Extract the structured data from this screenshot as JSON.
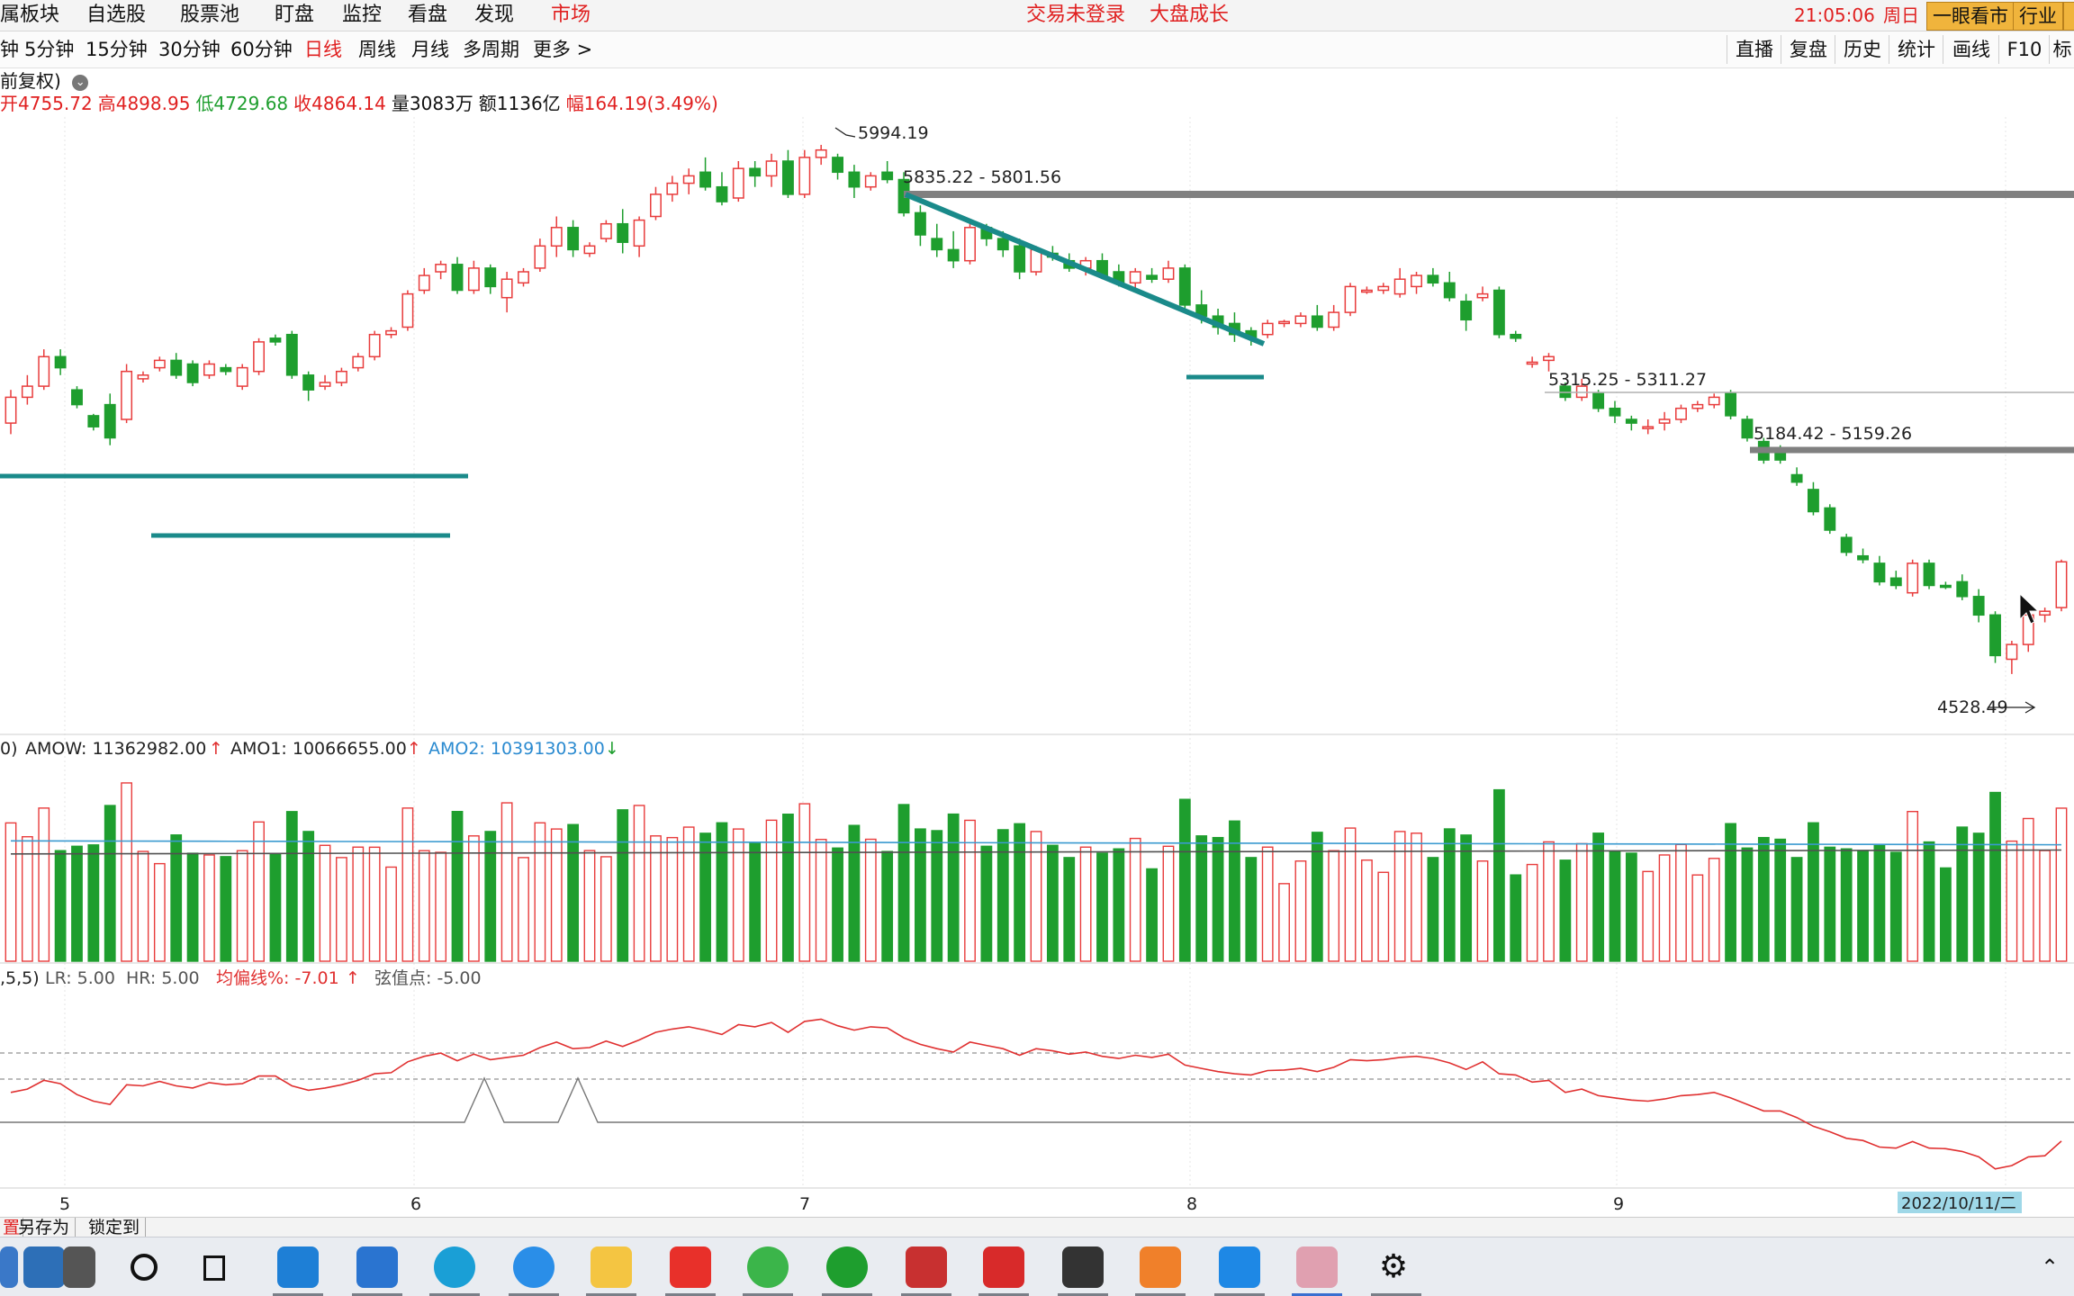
{
  "menu": {
    "items": [
      "属板块",
      "自选股",
      "股票池",
      "盯盘",
      "监控",
      "看盘",
      "发现",
      "市场"
    ],
    "status_text": "交易未登录",
    "center_text": "大盘成长",
    "clock": "21:05:06",
    "weekday": "周日",
    "badge_1": "一眼看市",
    "badge_2": "行业"
  },
  "period": {
    "items": [
      "钟",
      "5分钟",
      "15分钟",
      "30分钟",
      "60分钟",
      "日线",
      "周线",
      "月线",
      "多周期",
      "更多 >"
    ],
    "active": "日线"
  },
  "tools": [
    "直播",
    "复盘",
    "历史",
    "统计",
    "画线",
    "F10",
    "标"
  ],
  "info": {
    "adjust_label": "前复权)",
    "open": "开4755.72",
    "high": "高4898.95",
    "low": "低4729.68",
    "close": "收4864.14",
    "volume": "量3083万",
    "amount": "额1136亿",
    "change": "幅164.19(3.49%)"
  },
  "colors": {
    "up": "#e83c3c",
    "down": "#1e9e2e",
    "trendline": "#1a8a8a",
    "resistance": "#808080",
    "amo_ma1": "#3a9ad0",
    "amo_ma2": "#505050",
    "osc": "#e03030"
  },
  "annotations": {
    "peak": "5994.19",
    "range_1": "5835.22 - 5801.56",
    "range_2": "5315.25 - 5311.27",
    "range_3": "5184.42 - 5159.26",
    "low": "4528.49"
  },
  "amo": {
    "prefix": "0)",
    "amow": "AMOW: 11362982.00",
    "amo1": "AMO1: 10066655.00",
    "amo2": "AMO2: 10391303.00"
  },
  "osc": {
    "prefix": ",5,5)",
    "lr": "LR: 5.00",
    "hr": "HR: 5.00",
    "bias": "均偏线%: -7.01",
    "chord": "弦值点: -5.00"
  },
  "xaxis": {
    "ticks": [
      "5",
      "6",
      "7",
      "8",
      "9"
    ],
    "cursor_date": "2022/10/11/二"
  },
  "bottom_tabs": [
    "置",
    "另存为",
    "锁定到"
  ],
  "chart_data": {
    "type": "candlestick",
    "price_range": [
      4450,
      6050
    ],
    "candles": [
      [
        5240,
        5330,
        5210,
        5310
      ],
      [
        5310,
        5370,
        5290,
        5340
      ],
      [
        5340,
        5440,
        5330,
        5420
      ],
      [
        5420,
        5440,
        5370,
        5390
      ],
      [
        5330,
        5340,
        5280,
        5290
      ],
      [
        5260,
        5265,
        5220,
        5230
      ],
      [
        5290,
        5320,
        5180,
        5200
      ],
      [
        5250,
        5400,
        5240,
        5380
      ],
      [
        5360,
        5380,
        5350,
        5370
      ],
      [
        5390,
        5420,
        5380,
        5410
      ],
      [
        5410,
        5430,
        5360,
        5370
      ],
      [
        5400,
        5410,
        5340,
        5350
      ],
      [
        5370,
        5410,
        5360,
        5400
      ],
      [
        5390,
        5400,
        5370,
        5380
      ],
      [
        5340,
        5400,
        5330,
        5390
      ],
      [
        5380,
        5470,
        5370,
        5460
      ],
      [
        5470,
        5480,
        5450,
        5460
      ],
      [
        5480,
        5490,
        5360,
        5370
      ],
      [
        5370,
        5380,
        5300,
        5330
      ],
      [
        5340,
        5370,
        5330,
        5350
      ],
      [
        5350,
        5390,
        5340,
        5380
      ],
      [
        5390,
        5430,
        5380,
        5420
      ],
      [
        5420,
        5490,
        5410,
        5480
      ],
      [
        5480,
        5500,
        5470,
        5490
      ],
      [
        5500,
        5600,
        5490,
        5590
      ],
      [
        5600,
        5660,
        5590,
        5640
      ],
      [
        5650,
        5680,
        5630,
        5670
      ],
      [
        5670,
        5690,
        5590,
        5600
      ],
      [
        5600,
        5680,
        5590,
        5660
      ],
      [
        5660,
        5670,
        5590,
        5610
      ],
      [
        5580,
        5650,
        5540,
        5630
      ],
      [
        5620,
        5660,
        5610,
        5650
      ],
      [
        5660,
        5740,
        5650,
        5720
      ],
      [
        5720,
        5800,
        5690,
        5770
      ],
      [
        5770,
        5790,
        5690,
        5710
      ],
      [
        5700,
        5730,
        5690,
        5720
      ],
      [
        5740,
        5790,
        5730,
        5780
      ],
      [
        5780,
        5820,
        5700,
        5730
      ],
      [
        5720,
        5800,
        5690,
        5790
      ],
      [
        5800,
        5880,
        5790,
        5860
      ],
      [
        5860,
        5910,
        5840,
        5890
      ],
      [
        5890,
        5930,
        5860,
        5910
      ],
      [
        5920,
        5960,
        5870,
        5880
      ],
      [
        5880,
        5920,
        5830,
        5840
      ],
      [
        5850,
        5950,
        5840,
        5930
      ],
      [
        5930,
        5950,
        5880,
        5910
      ],
      [
        5910,
        5970,
        5880,
        5950
      ],
      [
        5950,
        5980,
        5850,
        5860
      ],
      [
        5860,
        5980,
        5850,
        5960
      ],
      [
        5960,
        5994,
        5940,
        5980
      ],
      [
        5960,
        5970,
        5900,
        5920
      ],
      [
        5920,
        5940,
        5850,
        5880
      ],
      [
        5880,
        5920,
        5870,
        5910
      ],
      [
        5920,
        5950,
        5890,
        5900
      ],
      [
        5900,
        5920,
        5800,
        5810
      ],
      [
        5810,
        5830,
        5720,
        5750
      ],
      [
        5740,
        5780,
        5690,
        5710
      ],
      [
        5710,
        5760,
        5660,
        5680
      ],
      [
        5680,
        5790,
        5670,
        5770
      ],
      [
        5770,
        5780,
        5720,
        5740
      ],
      [
        5740,
        5760,
        5690,
        5710
      ],
      [
        5720,
        5740,
        5630,
        5650
      ],
      [
        5650,
        5720,
        5640,
        5710
      ],
      [
        5700,
        5720,
        5680,
        5690
      ],
      [
        5680,
        5700,
        5650,
        5660
      ],
      [
        5660,
        5690,
        5640,
        5680
      ],
      [
        5680,
        5700,
        5630,
        5640
      ],
      [
        5650,
        5670,
        5610,
        5620
      ],
      [
        5620,
        5660,
        5600,
        5650
      ],
      [
        5640,
        5660,
        5620,
        5630
      ],
      [
        5630,
        5680,
        5620,
        5660
      ],
      [
        5660,
        5670,
        5550,
        5560
      ],
      [
        5560,
        5600,
        5510,
        5530
      ],
      [
        5530,
        5550,
        5480,
        5500
      ],
      [
        5510,
        5540,
        5460,
        5480
      ],
      [
        5490,
        5500,
        5450,
        5470
      ],
      [
        5480,
        5520,
        5470,
        5510
      ],
      [
        5510,
        5520,
        5500,
        5515
      ],
      [
        5510,
        5540,
        5500,
        5530
      ],
      [
        5530,
        5560,
        5490,
        5500
      ],
      [
        5500,
        5560,
        5490,
        5540
      ],
      [
        5540,
        5620,
        5530,
        5610
      ],
      [
        5600,
        5610,
        5590,
        5600
      ],
      [
        5600,
        5620,
        5590,
        5610
      ],
      [
        5590,
        5660,
        5580,
        5630
      ],
      [
        5610,
        5650,
        5590,
        5640
      ],
      [
        5640,
        5660,
        5610,
        5620
      ],
      [
        5620,
        5650,
        5570,
        5580
      ],
      [
        5570,
        5590,
        5490,
        5520
      ],
      [
        5580,
        5610,
        5570,
        5590
      ],
      [
        5600,
        5610,
        5470,
        5480
      ],
      [
        5480,
        5490,
        5460,
        5470
      ],
      [
        5400,
        5420,
        5390,
        5405
      ],
      [
        5410,
        5430,
        5380,
        5420
      ],
      [
        5340,
        5350,
        5300,
        5310
      ],
      [
        5310,
        5360,
        5300,
        5340
      ],
      [
        5320,
        5330,
        5270,
        5280
      ],
      [
        5280,
        5300,
        5240,
        5260
      ],
      [
        5250,
        5260,
        5220,
        5240
      ],
      [
        5230,
        5250,
        5210,
        5230
      ],
      [
        5240,
        5270,
        5220,
        5250
      ],
      [
        5250,
        5290,
        5240,
        5280
      ],
      [
        5280,
        5300,
        5270,
        5290
      ],
      [
        5290,
        5320,
        5280,
        5310
      ],
      [
        5320,
        5330,
        5250,
        5260
      ],
      [
        5250,
        5260,
        5190,
        5200
      ],
      [
        5190,
        5200,
        5130,
        5140
      ],
      [
        5160,
        5180,
        5130,
        5140
      ],
      [
        5100,
        5120,
        5070,
        5080
      ],
      [
        5060,
        5080,
        4990,
        5000
      ],
      [
        5010,
        5020,
        4940,
        4950
      ],
      [
        4930,
        4940,
        4880,
        4890
      ],
      [
        4880,
        4900,
        4860,
        4870
      ],
      [
        4860,
        4880,
        4800,
        4810
      ],
      [
        4820,
        4840,
        4790,
        4800
      ],
      [
        4780,
        4870,
        4770,
        4860
      ],
      [
        4860,
        4870,
        4790,
        4800
      ],
      [
        4800,
        4810,
        4790,
        4795
      ],
      [
        4810,
        4830,
        4760,
        4770
      ],
      [
        4770,
        4790,
        4700,
        4720
      ],
      [
        4720,
        4730,
        4590,
        4610
      ],
      [
        4600,
        4650,
        4560,
        4640
      ],
      [
        4640,
        4730,
        4620,
        4720
      ],
      [
        4720,
        4740,
        4700,
        4730
      ],
      [
        4740,
        4870,
        4730,
        4864
      ]
    ],
    "volume_range": [
      0,
      15000000
    ],
    "amo_ma1": 9200000,
    "amo_ma2": 8200000,
    "horizontal_levels": [
      5835.22,
      5315.25,
      5184.42
    ],
    "x_ticks": [
      "5",
      "6",
      "7",
      "8",
      "9"
    ]
  }
}
